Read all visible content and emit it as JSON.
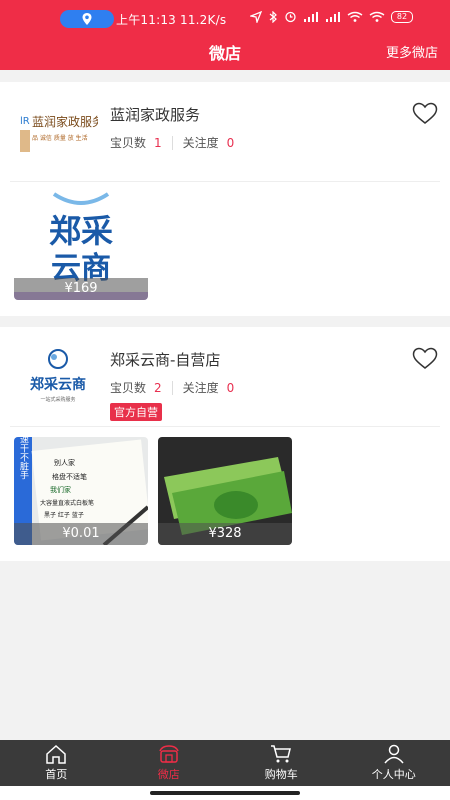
{
  "status_bar": {
    "time_speed": "上午11:13   11.2K/s",
    "battery": "82"
  },
  "header": {
    "title": "微店",
    "more_link": "更多微店"
  },
  "shops": [
    {
      "name": "蓝润家政服务",
      "logo_text": "蓝润家政服务",
      "logo_sub": "品 诚信 质量 放 生活",
      "items_label": "宝贝数",
      "items_count": "1",
      "follow_label": "关注度",
      "follow_count": "0",
      "products": [
        {
          "price": "¥169",
          "img_line1": "郑采",
          "img_line2": "云商"
        }
      ]
    },
    {
      "name": "郑采云商-自营店",
      "logo_text": "郑采云商",
      "logo_sub": "一站式采购服务",
      "items_label": "宝贝数",
      "items_count": "2",
      "follow_label": "关注度",
      "follow_count": "0",
      "badge": "官方自营",
      "products": [
        {
          "price": "¥0.01",
          "img_side": "速干不脏手",
          "img_l1": "别人家",
          "img_l2": "格盘不适笔",
          "img_l3": "我们家",
          "img_l4": "大容量直液式白板笔",
          "img_l5": "黑子 红子 蓝子"
        },
        {
          "price": "¥328"
        }
      ]
    }
  ],
  "tabbar": {
    "home": "首页",
    "shop": "微店",
    "cart": "购物车",
    "profile": "个人中心"
  },
  "colors": {
    "brand_red": "#ef2d47",
    "tab_bg": "#3a3a3a"
  }
}
